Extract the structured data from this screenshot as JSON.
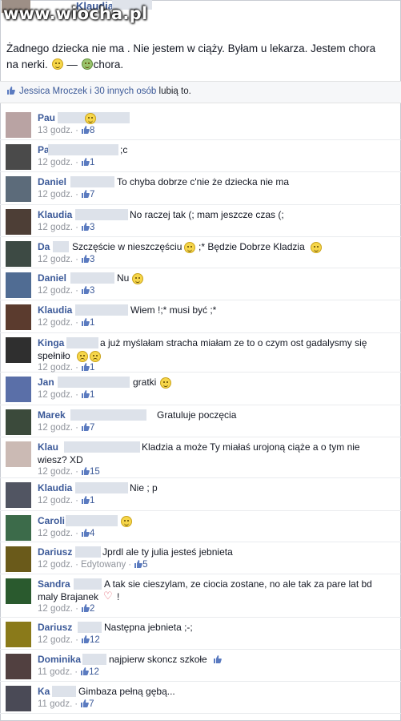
{
  "watermark": "www.wiocha.pl",
  "post": {
    "author": "Klaudia",
    "text_1": "Żadnego dziecka nie ma . Nie jestem w ciąży. Byłam u lekarza. Jestem chora na nerki.",
    "feeling_sep": "—",
    "feeling": "chora."
  },
  "likes": {
    "who": "Jessica Mroczek i 30 innych osób",
    "suffix": " lubią to."
  },
  "comments": [
    {
      "name": "Pau",
      "text": "",
      "time": "13 godz.",
      "likes": "8"
    },
    {
      "name": "Pa",
      "text": ";c",
      "time": "12 godz.",
      "likes": "1"
    },
    {
      "name": "Daniel",
      "text": "To chyba dobrze c'nie że dziecka nie ma",
      "time": "12 godz.",
      "likes": "7"
    },
    {
      "name": "Klaudia",
      "text": "No raczej tak (; mam jeszcze czas (;",
      "time": "12 godz.",
      "likes": "3"
    },
    {
      "name": "Da",
      "text": "Szczęście w nieszczęściu",
      "text_b": ";* Będzie Dobrze Kladzia",
      "time": "12 godz.",
      "likes": "3"
    },
    {
      "name": "Daniel",
      "text": "Nu",
      "time": "12 godz.",
      "likes": "3"
    },
    {
      "name": "Klaudia",
      "text": "Wiem !;* musi być ;*",
      "time": "12 godz.",
      "likes": "1"
    },
    {
      "name": "Kinga",
      "text": "a już myślałam stracha miałam ze to o czym ost gadalysmy się",
      "text_b": "spełniło",
      "time": "12 godz.",
      "likes": "1"
    },
    {
      "name": "Jan",
      "text": "gratki",
      "time": "12 godz.",
      "likes": "1"
    },
    {
      "name": "Marek",
      "text": "Gratuluje poczęcia",
      "time": "12 godz.",
      "likes": "7"
    },
    {
      "name": "Klau",
      "text": "Kladzia a może Ty miałaś urojoną ciąże a o tym nie",
      "text_b": "wiesz? XD",
      "time": "12 godz.",
      "likes": "15"
    },
    {
      "name": "Klaudia",
      "text": "Nie ; p",
      "time": "12 godz.",
      "likes": "1"
    },
    {
      "name": "Caroli",
      "text": "",
      "time": "12 godz.",
      "likes": "4"
    },
    {
      "name": "Dariusz",
      "text": "Jprdl ale ty julia jesteś jebnieta",
      "time": "12 godz.",
      "edited": "Edytowany",
      "likes": "5"
    },
    {
      "name": "Sandra",
      "text": "A tak sie cieszylam, ze ciocia zostane, no ale tak za pare lat bd",
      "text_b": "maly Brajanek",
      "text_c": "!",
      "time": "12 godz.",
      "likes": "2"
    },
    {
      "name": "Dariusz",
      "text": "Następna jebnieta ;-;",
      "time": "12 godz.",
      "likes": "12"
    },
    {
      "name": "Dominika",
      "text": "najpierw skoncz szkołe",
      "time": "11 godz.",
      "likes": "12"
    },
    {
      "name": "Ka",
      "text": "Gimbaza pełną gębą...",
      "time": "11 godz.",
      "likes": "7"
    }
  ]
}
